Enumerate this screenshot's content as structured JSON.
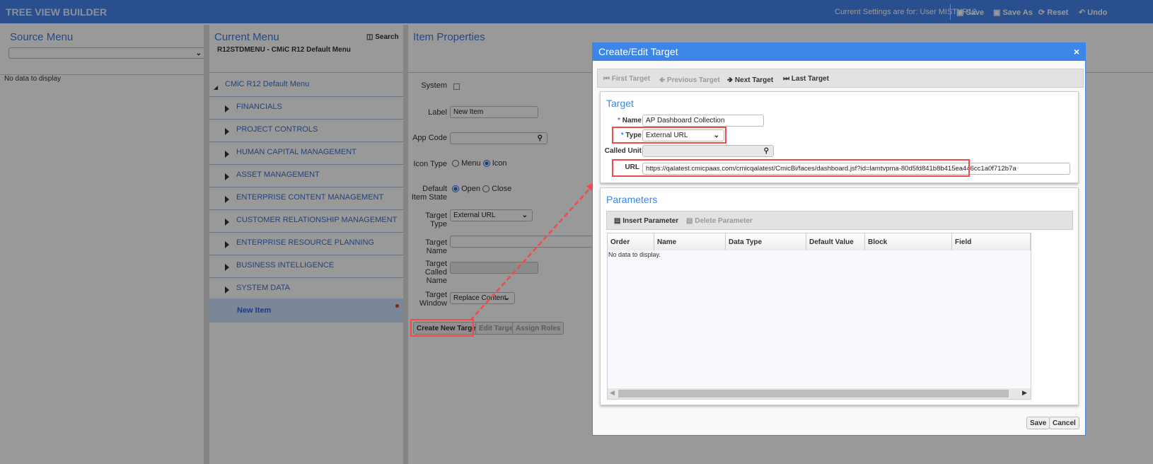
{
  "app": {
    "title": "TREE VIEW BUILDER",
    "settings_text": "Current Settings are for: User MISTYR12",
    "actions": [
      {
        "label": "Save",
        "icon": "floppy-icon"
      },
      {
        "label": "Save As",
        "icon": "floppy-icon"
      },
      {
        "label": "Reset",
        "icon": "reset-icon"
      },
      {
        "label": "Undo",
        "icon": "undo-icon"
      }
    ]
  },
  "source_menu": {
    "title": "Source Menu",
    "select_value": "",
    "empty_text": "No data to display"
  },
  "current_menu": {
    "title": "Current Menu",
    "search_label": "Search",
    "subtitle": "R12STDMENU - CMiC R12 Default Menu",
    "root": "CMiC R12 Default Menu",
    "items": [
      "FINANCIALS",
      "PROJECT CONTROLS",
      "HUMAN CAPITAL MANAGEMENT",
      "ASSET MANAGEMENT",
      "ENTERPRISE CONTENT MANAGEMENT",
      "CUSTOMER RELATIONSHIP MANAGEMENT",
      "ENTERPRISE RESOURCE PLANNING",
      "BUSINESS INTELLIGENCE",
      "SYSTEM DATA"
    ],
    "selected": "New Item"
  },
  "item_properties": {
    "title": "Item Properties",
    "system_label": "System",
    "system_checked": false,
    "label_label": "Label",
    "label_value": "New Item",
    "app_code_label": "App Code",
    "app_code_value": "",
    "icon_type_label": "Icon Type",
    "icon_type_options": [
      "Menu",
      "Icon"
    ],
    "icon_type_selected": "Icon",
    "default_state_label": "Default Item State",
    "default_state_options": [
      "Open",
      "Close"
    ],
    "default_state_selected": "Open",
    "target_type_label": "Target Type",
    "target_type_value": "External URL",
    "target_name_label": "Target Name",
    "target_name_value": "",
    "target_called_name_label": "Target Called Name",
    "target_window_label": "Target Window",
    "target_window_value": "Replace Content",
    "buttons": {
      "create": "Create New Target",
      "edit": "Edit Target",
      "assign": "Assign Roles"
    }
  },
  "dialog": {
    "title": "Create/Edit Target",
    "close": "×",
    "nav": {
      "first": "First Target",
      "previous": "Previous Target",
      "next": "Next Target",
      "last": "Last Target"
    },
    "target": {
      "title": "Target",
      "name_label": "Name",
      "name_value": "AP Dashboard Collection",
      "type_label": "Type",
      "type_value": "External URL",
      "called_unit_label": "Called Unit",
      "called_unit_value": "",
      "url_label": "URL",
      "url_value": "https://qalatest.cmicpaas.com/cmicqalatest/CmicBi/faces/dashboard.jsf?id=lamtvpma-80d5fd841b8b415ea446cc1a0f712b7a",
      "required_mark": "*"
    },
    "parameters": {
      "title": "Parameters",
      "insert": "Insert Parameter",
      "delete": "Delete Parameter",
      "columns": [
        "Order",
        "Name",
        "Data Type",
        "Default Value",
        "Block",
        "Field"
      ],
      "empty_text": "No data to display."
    },
    "save": "Save",
    "cancel": "Cancel"
  },
  "colors": {
    "header": "#4784ee",
    "dialog_title": "#3d86e8",
    "highlight": "#f04a4a"
  }
}
